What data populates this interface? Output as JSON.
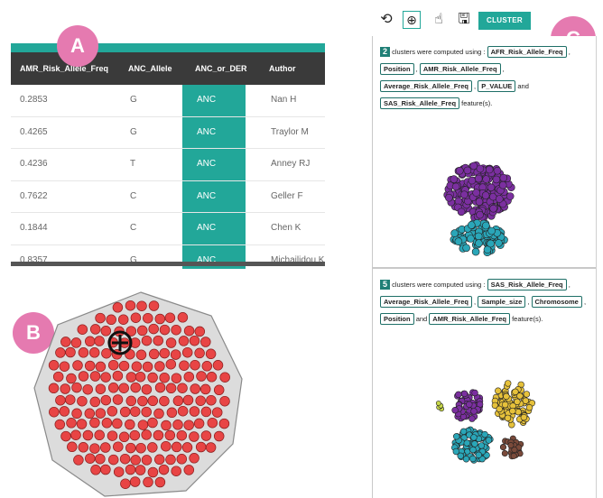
{
  "badges": {
    "a": "A",
    "b": "B",
    "c": "C"
  },
  "table": {
    "columns": [
      "AMR_Risk_Allele_Freq",
      "ANC_Allele",
      "ANC_or_DER",
      "Author"
    ],
    "rows": [
      [
        "0.2853",
        "G",
        "ANC",
        "Nan H"
      ],
      [
        "0.4265",
        "G",
        "ANC",
        "Traylor M"
      ],
      [
        "0.4236",
        "T",
        "ANC",
        "Anney RJ"
      ],
      [
        "0.7622",
        "C",
        "ANC",
        "Geller F"
      ],
      [
        "0.1844",
        "C",
        "ANC",
        "Chen K"
      ],
      [
        "0.8357",
        "G",
        "ANC",
        "Michailidou K"
      ]
    ]
  },
  "toolbar": {
    "icons": [
      "reset-icon",
      "zoom-in-icon",
      "pointer-icon",
      "save-icon"
    ],
    "cluster_label": "CLUSTER"
  },
  "results": [
    {
      "count": "2",
      "prefix": "clusters were computed using :",
      "features": [
        "AFR_Risk_Allele_Freq",
        "Position",
        "AMR_Risk_Allele_Freq",
        "Average_Risk_Allele_Freq",
        "P_VALUE",
        "SAS_Risk_Allele_Freq"
      ],
      "and_word": "and",
      "suffix": "feature(s)."
    },
    {
      "count": "5",
      "prefix": "clusters were computed using :",
      "features": [
        "SAS_Risk_Allele_Freq",
        "Average_Risk_Allele_Freq",
        "Sample_size",
        "Chromosome",
        "Position",
        "AMR_Risk_Allele_Freq"
      ],
      "and_word": "and",
      "suffix": "feature(s)."
    }
  ],
  "colors": {
    "teal": "#22a799",
    "header_dark": "#3a3a3a",
    "badge_pink": "#e57ab0",
    "node_red": "#e84545",
    "purple": "#7b2fa0",
    "cyan": "#2aa6b8",
    "yellow": "#e6c13a",
    "brown": "#7a4a3a",
    "lime": "#c8d84a"
  }
}
